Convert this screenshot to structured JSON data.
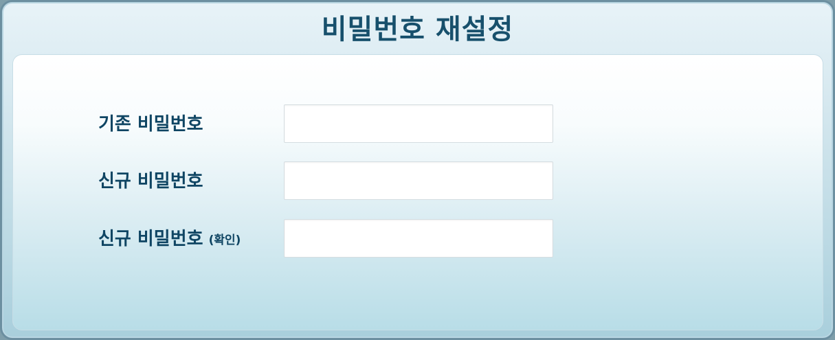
{
  "dialog": {
    "title": "비밀번호 재설정"
  },
  "form": {
    "fields": [
      {
        "label": "기존 비밀번호",
        "suffix": "",
        "value": "",
        "placeholder": ""
      },
      {
        "label": "신규 비밀번호",
        "suffix": "",
        "value": "",
        "placeholder": ""
      },
      {
        "label": "신규 비밀번호",
        "suffix": "(확인)",
        "value": "",
        "placeholder": ""
      }
    ]
  },
  "colors": {
    "title_text": "#17506c",
    "label_text": "#0f4563",
    "frame_border": "#6c8fa0"
  }
}
